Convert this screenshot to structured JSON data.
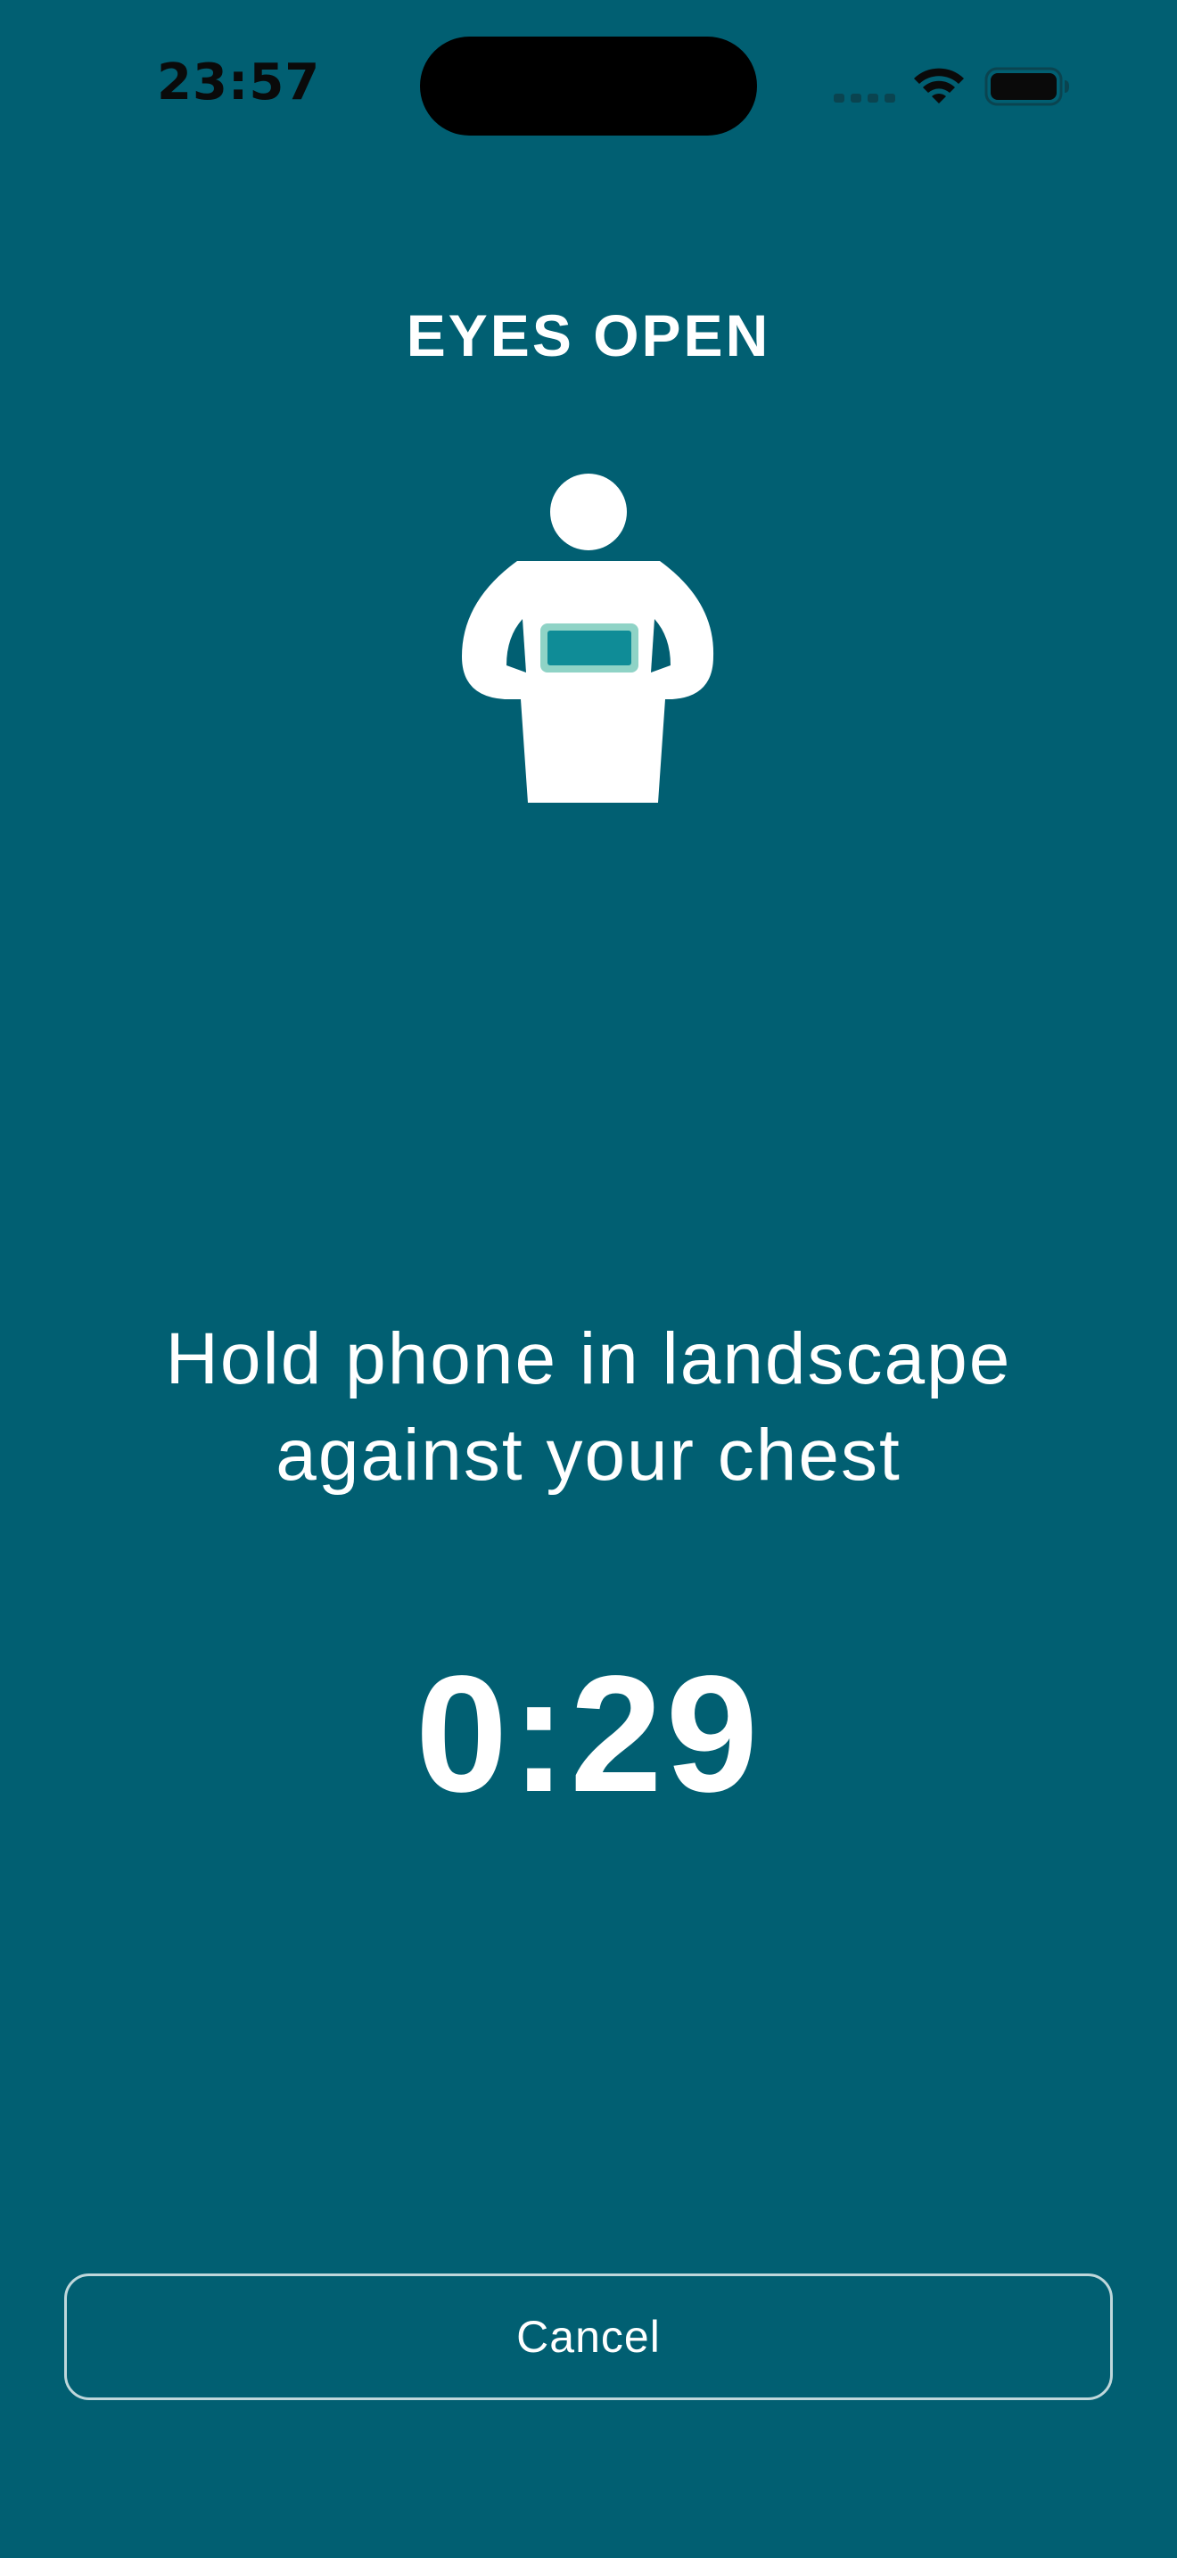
{
  "status_bar": {
    "time": "23:57",
    "icons": [
      "cellular-signal-icon",
      "wifi-icon",
      "battery-icon"
    ]
  },
  "screen": {
    "title": "EYES OPEN",
    "illustration": "person-holding-phone-icon",
    "instruction": "Hold phone in landscape against your chest",
    "timer": "0:29"
  },
  "actions": {
    "cancel_label": "Cancel"
  },
  "colors": {
    "background": "#015f72",
    "foreground": "#ffffff",
    "phone_screen": "#0f8c97",
    "phone_frame": "#8fd3c6"
  }
}
